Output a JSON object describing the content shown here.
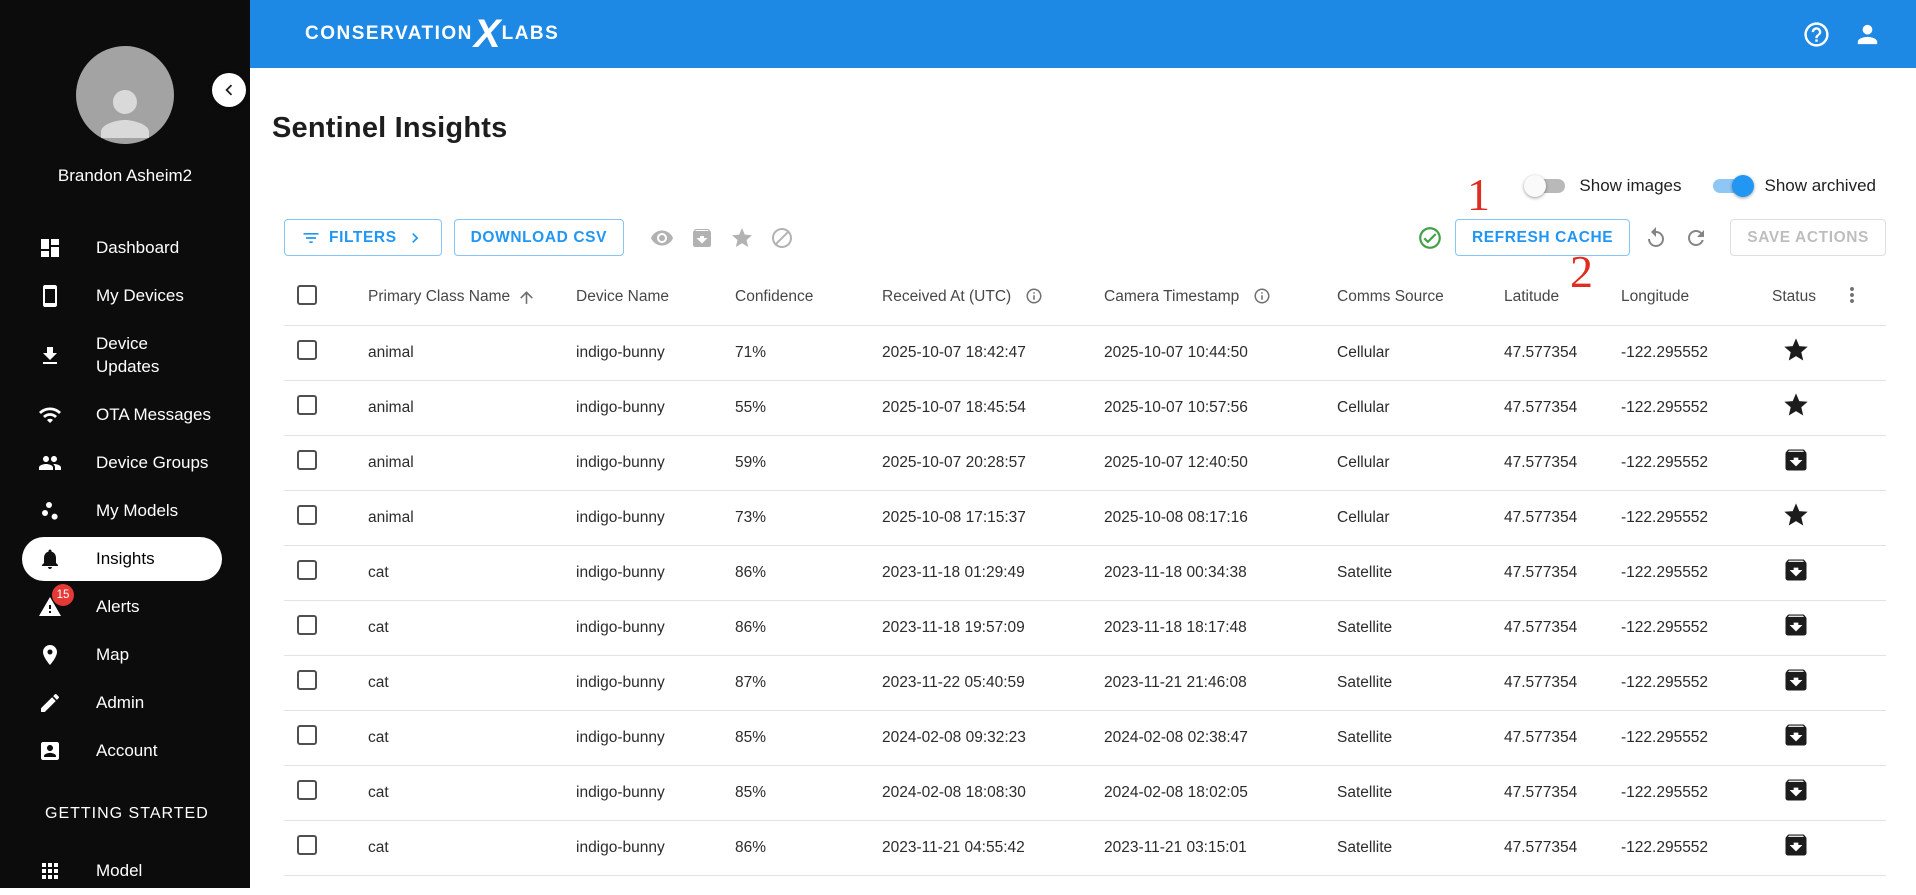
{
  "topbar": {
    "logo": {
      "word1": "CONSERVATION",
      "x": "X",
      "word2": "LABS"
    }
  },
  "sidebar": {
    "username": "Brandon Asheim2",
    "items": [
      {
        "label": "Dashboard",
        "icon": "dashboard-icon"
      },
      {
        "label": "My Devices",
        "icon": "devices-icon"
      },
      {
        "label": "Device Updates",
        "icon": "download-icon",
        "multiline": true
      },
      {
        "label": "OTA Messages",
        "icon": "wifi-icon"
      },
      {
        "label": "Device Groups",
        "icon": "people-icon"
      },
      {
        "label": "My Models",
        "icon": "scatter-icon"
      },
      {
        "label": "Insights",
        "icon": "bell-icon",
        "active": true
      },
      {
        "label": "Alerts",
        "icon": "warning-icon",
        "badge": "15"
      },
      {
        "label": "Map",
        "icon": "map-pin-icon"
      },
      {
        "label": "Admin",
        "icon": "pencil-icon"
      },
      {
        "label": "Account",
        "icon": "account-box-icon"
      }
    ],
    "section_header": "GETTING STARTED",
    "bottom_items": [
      {
        "label": "Model",
        "icon": "apps-icon"
      }
    ]
  },
  "main": {
    "title": "Sentinel Insights",
    "toggles": {
      "show_images_label": "Show images",
      "show_archived_label": "Show archived"
    },
    "annotations": [
      {
        "label": "1"
      },
      {
        "label": "2"
      }
    ],
    "toolbar": {
      "filters_label": "FILTERS",
      "download_csv_label": "DOWNLOAD CSV",
      "refresh_cache_label": "REFRESH CACHE",
      "save_actions_label": "SAVE ACTIONS"
    },
    "table": {
      "columns": {
        "primary": "Primary Class Name",
        "device": "Device Name",
        "confidence": "Confidence",
        "received": "Received At (UTC)",
        "camera": "Camera Timestamp",
        "comms": "Comms Source",
        "latitude": "Latitude",
        "longitude": "Longitude",
        "status": "Status"
      },
      "rows": [
        {
          "primary_class": "animal",
          "device_name": "indigo-bunny",
          "confidence": "71%",
          "received_at": "2025-10-07 18:42:47",
          "camera_timestamp": "2025-10-07 10:44:50",
          "comms_source": "Cellular",
          "latitude": "47.577354",
          "longitude": "-122.295552",
          "status": "star"
        },
        {
          "primary_class": "animal",
          "device_name": "indigo-bunny",
          "confidence": "55%",
          "received_at": "2025-10-07 18:45:54",
          "camera_timestamp": "2025-10-07 10:57:56",
          "comms_source": "Cellular",
          "latitude": "47.577354",
          "longitude": "-122.295552",
          "status": "star"
        },
        {
          "primary_class": "animal",
          "device_name": "indigo-bunny",
          "confidence": "59%",
          "received_at": "2025-10-07 20:28:57",
          "camera_timestamp": "2025-10-07 12:40:50",
          "comms_source": "Cellular",
          "latitude": "47.577354",
          "longitude": "-122.295552",
          "status": "archive"
        },
        {
          "primary_class": "animal",
          "device_name": "indigo-bunny",
          "confidence": "73%",
          "received_at": "2025-10-08 17:15:37",
          "camera_timestamp": "2025-10-08 08:17:16",
          "comms_source": "Cellular",
          "latitude": "47.577354",
          "longitude": "-122.295552",
          "status": "star"
        },
        {
          "primary_class": "cat",
          "device_name": "indigo-bunny",
          "confidence": "86%",
          "received_at": "2023-11-18 01:29:49",
          "camera_timestamp": "2023-11-18 00:34:38",
          "comms_source": "Satellite",
          "latitude": "47.577354",
          "longitude": "-122.295552",
          "status": "archive"
        },
        {
          "primary_class": "cat",
          "device_name": "indigo-bunny",
          "confidence": "86%",
          "received_at": "2023-11-18 19:57:09",
          "camera_timestamp": "2023-11-18 18:17:48",
          "comms_source": "Satellite",
          "latitude": "47.577354",
          "longitude": "-122.295552",
          "status": "archive"
        },
        {
          "primary_class": "cat",
          "device_name": "indigo-bunny",
          "confidence": "87%",
          "received_at": "2023-11-22 05:40:59",
          "camera_timestamp": "2023-11-21 21:46:08",
          "comms_source": "Satellite",
          "latitude": "47.577354",
          "longitude": "-122.295552",
          "status": "archive"
        },
        {
          "primary_class": "cat",
          "device_name": "indigo-bunny",
          "confidence": "85%",
          "received_at": "2024-02-08 09:32:23",
          "camera_timestamp": "2024-02-08 02:38:47",
          "comms_source": "Satellite",
          "latitude": "47.577354",
          "longitude": "-122.295552",
          "status": "archive"
        },
        {
          "primary_class": "cat",
          "device_name": "indigo-bunny",
          "confidence": "85%",
          "received_at": "2024-02-08 18:08:30",
          "camera_timestamp": "2024-02-08 18:02:05",
          "comms_source": "Satellite",
          "latitude": "47.577354",
          "longitude": "-122.295552",
          "status": "archive"
        },
        {
          "primary_class": "cat",
          "device_name": "indigo-bunny",
          "confidence": "86%",
          "received_at": "2023-11-21 04:55:42",
          "camera_timestamp": "2023-11-21 03:15:01",
          "comms_source": "Satellite",
          "latitude": "47.577354",
          "longitude": "-122.295552",
          "status": "archive"
        }
      ]
    }
  },
  "colors": {
    "topbar_blue": "#1e88e5",
    "accent_blue": "#2196f3",
    "annotation_red": "#e02d24",
    "badge_red": "#e53935",
    "success_green": "#43a047",
    "sidebar_black": "#0c0c0c"
  }
}
